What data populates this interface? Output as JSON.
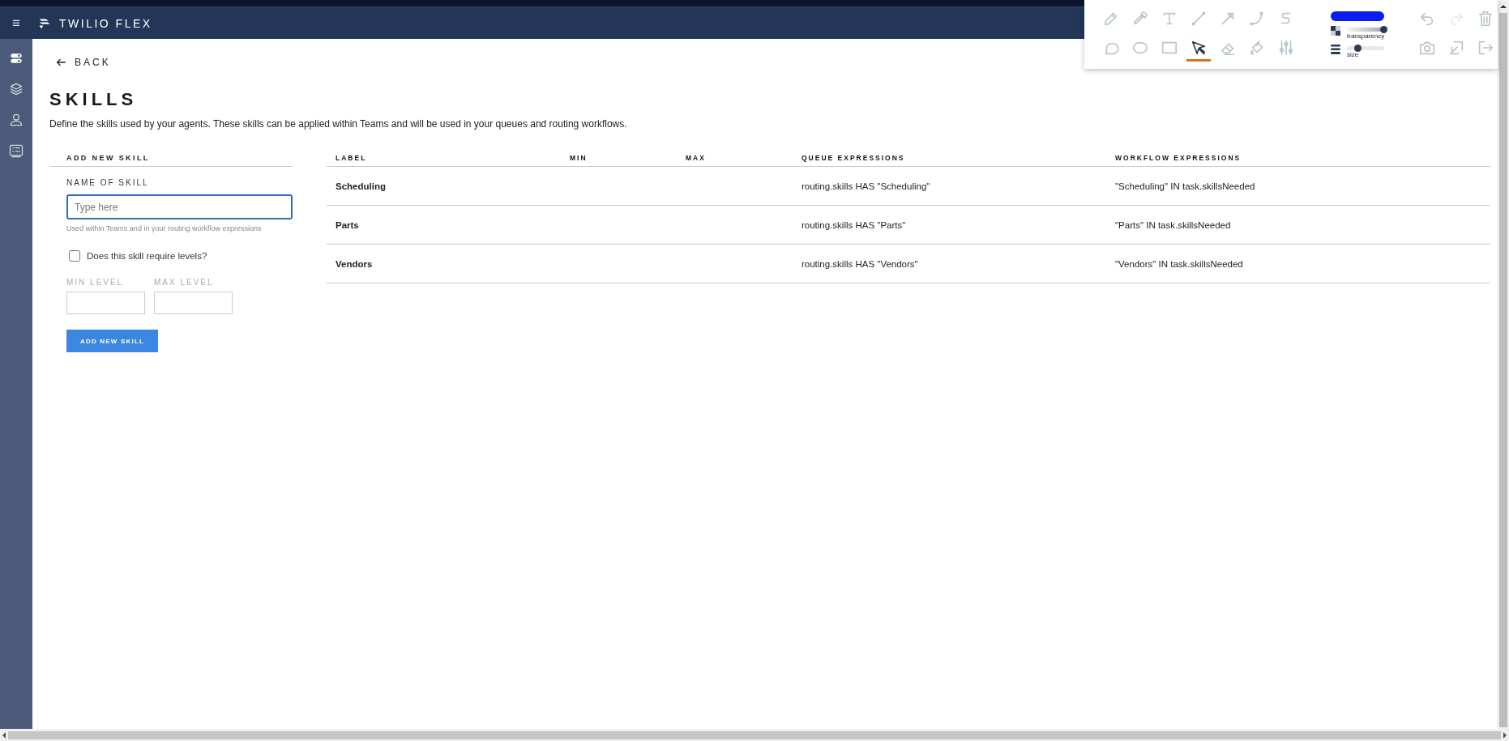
{
  "header": {
    "menu_icon": "≡",
    "title": "TWILIO FLEX"
  },
  "sidebar": {
    "items": [
      {
        "kind": "toggles",
        "selected": true
      },
      {
        "kind": "layers",
        "selected": false
      },
      {
        "kind": "agent",
        "selected": false
      },
      {
        "kind": "skills",
        "selected": false
      }
    ]
  },
  "back_link": "BACK",
  "page_title": "SKILLS",
  "description": "Define the skills used by your agents. These skills can be applied within Teams and will be used in your queues and routing workflows.",
  "add_skill_form": {
    "section_title": "ADD NEW SKILL",
    "name_label": "NAME OF SKILL",
    "name_placeholder": "Type here",
    "helper_text": "Used within Teams and in your routing workflow expressions",
    "levels_checkbox": {
      "label": "Does this skill require levels?",
      "checked": false
    },
    "min_level_label": "MIN LEVEL",
    "max_level_label": "MAX LEVEL",
    "levels_disabled": true,
    "submit_button": "ADD NEW SKILL"
  },
  "table": {
    "columns": [
      "LABEL",
      "MIN",
      "MAX",
      "QUEUE EXPRESSIONS",
      "WORKFLOW EXPRESSIONS"
    ],
    "rows": [
      {
        "label": "Scheduling",
        "queue_expression": "routing.skills HAS \"Scheduling\"",
        "workflow_expression": "\"Scheduling\" IN task.skillsNeeded"
      },
      {
        "label": "Parts",
        "queue_expression": "routing.skills HAS \"Parts\"",
        "workflow_expression": "\"Parts\" IN task.skillsNeeded"
      },
      {
        "label": "Vendors",
        "queue_expression": "routing.skills HAS \"Vendors\"",
        "workflow_expression": "\"Vendors\" IN task.skillsNeeded"
      }
    ]
  },
  "drawing_toolbar": {
    "tools": [
      {
        "kind": "pencil",
        "selected": false
      },
      {
        "kind": "eyedropper",
        "selected": false
      },
      {
        "kind": "text",
        "selected": false
      },
      {
        "kind": "line",
        "selected": false
      },
      {
        "kind": "arrow",
        "selected": false
      },
      {
        "kind": "curve",
        "selected": false
      },
      {
        "kind": "squiggle",
        "selected": false
      },
      {
        "kind": "bubble",
        "selected": false
      },
      {
        "kind": "ellipse",
        "selected": false
      },
      {
        "kind": "rectangle",
        "selected": false
      },
      {
        "kind": "pointer",
        "selected": true
      },
      {
        "kind": "eraser",
        "selected": false
      },
      {
        "kind": "fill",
        "selected": false
      },
      {
        "kind": "sliders",
        "selected": false
      }
    ],
    "color": "#0a1ef0",
    "transparency": {
      "label": "transparency",
      "level": 1.0
    },
    "size": {
      "label": "size",
      "level": 0.3
    },
    "actions": [
      {
        "kind": "undo",
        "disabled": false
      },
      {
        "kind": "redo",
        "disabled": true
      },
      {
        "kind": "delete",
        "disabled": false
      },
      {
        "kind": "screenshot",
        "disabled": false
      },
      {
        "kind": "export",
        "disabled": false
      },
      {
        "kind": "exit",
        "disabled": false
      }
    ]
  }
}
